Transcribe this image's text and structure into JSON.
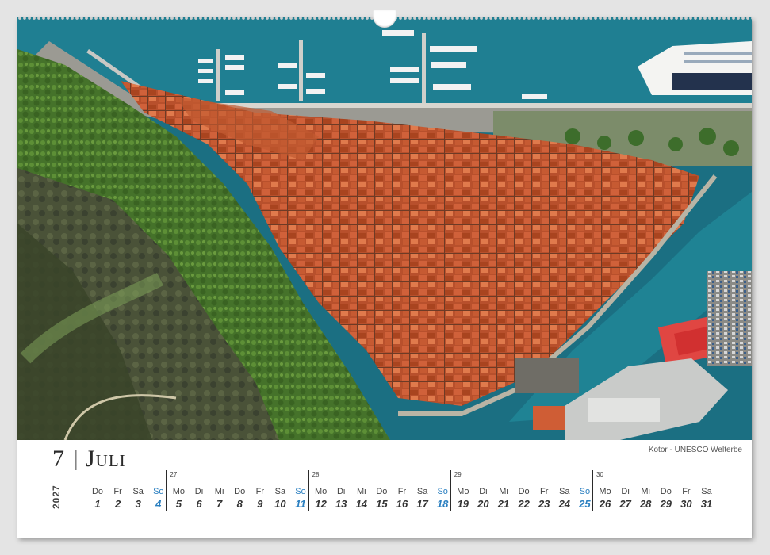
{
  "calendar": {
    "month_number": "7",
    "separator": "|",
    "month_name": "Juli",
    "year": "2027",
    "caption": "Kotor - UNESCO Welterbe",
    "weeks": [
      "27",
      "28",
      "29",
      "30"
    ],
    "days": [
      {
        "dn": "Do",
        "dd": "1"
      },
      {
        "dn": "Fr",
        "dd": "2"
      },
      {
        "dn": "Sa",
        "dd": "3"
      },
      {
        "dn": "So",
        "dd": "4"
      },
      {
        "dn": "Mo",
        "dd": "5"
      },
      {
        "dn": "Di",
        "dd": "6"
      },
      {
        "dn": "Mi",
        "dd": "7"
      },
      {
        "dn": "Do",
        "dd": "8"
      },
      {
        "dn": "Fr",
        "dd": "9"
      },
      {
        "dn": "Sa",
        "dd": "10"
      },
      {
        "dn": "So",
        "dd": "11"
      },
      {
        "dn": "Mo",
        "dd": "12"
      },
      {
        "dn": "Di",
        "dd": "13"
      },
      {
        "dn": "Mi",
        "dd": "14"
      },
      {
        "dn": "Do",
        "dd": "15"
      },
      {
        "dn": "Fr",
        "dd": "16"
      },
      {
        "dn": "Sa",
        "dd": "17"
      },
      {
        "dn": "So",
        "dd": "18"
      },
      {
        "dn": "Mo",
        "dd": "19"
      },
      {
        "dn": "Di",
        "dd": "20"
      },
      {
        "dn": "Mi",
        "dd": "21"
      },
      {
        "dn": "Do",
        "dd": "22"
      },
      {
        "dn": "Fr",
        "dd": "23"
      },
      {
        "dn": "Sa",
        "dd": "24"
      },
      {
        "dn": "So",
        "dd": "25"
      },
      {
        "dn": "Mo",
        "dd": "26"
      },
      {
        "dn": "Di",
        "dd": "27"
      },
      {
        "dn": "Mi",
        "dd": "28"
      },
      {
        "dn": "Do",
        "dd": "29"
      },
      {
        "dn": "Fr",
        "dd": "30"
      },
      {
        "dn": "Sa",
        "dd": "31"
      }
    ]
  },
  "colors": {
    "sunday": "#2a7fc0",
    "water": "#1f7f8f",
    "roofs": "#c4542b",
    "hillside": "#4d7a2c"
  }
}
